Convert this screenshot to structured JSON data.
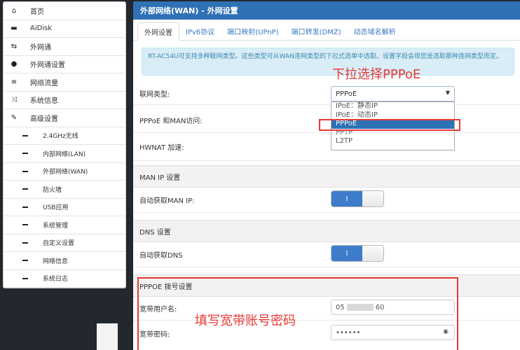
{
  "sidebar": {
    "items": [
      {
        "icon": "home-icon",
        "glyph": "⌂",
        "label": "首页"
      },
      {
        "icon": "drive-icon",
        "glyph": "▬",
        "label": "AiDisk"
      },
      {
        "icon": "guest-network-icon",
        "glyph": "⇆",
        "label": "外网通"
      },
      {
        "icon": "globe-icon",
        "glyph": "●",
        "label": "外网通设置"
      },
      {
        "icon": "traffic-icon",
        "glyph": "≡",
        "label": "网络流量"
      },
      {
        "icon": "shuffle-icon",
        "glyph": "⤨",
        "label": "系统信息"
      },
      {
        "icon": "wrench-icon",
        "glyph": "✎",
        "label": "高级设置"
      }
    ],
    "sub_items": [
      {
        "label": "2.4GHz无线"
      },
      {
        "label": "内部网络(LAN)"
      },
      {
        "label": "外部网络(WAN)"
      },
      {
        "label": "防火墙"
      },
      {
        "label": "USB应用"
      },
      {
        "label": "系统管理"
      },
      {
        "label": "自定义设置"
      },
      {
        "label": "网络信息"
      },
      {
        "label": "系统日志"
      }
    ]
  },
  "header": {
    "title": "外部网络(WAN) - 外网设置"
  },
  "tabs": [
    "外网设置",
    "IPv6协议",
    "端口映射(UPnP)",
    "端口转发(DMZ)",
    "动态域名解析"
  ],
  "info_text": "RT-AC54U可支持多种联网类型。这些类型可从WAN连网类型的下拉式选单中选取。设置字段会视您是选取那种连网类型而定。",
  "form": {
    "wan_type_label": "联网类型:",
    "wan_type_value": "PPPoE",
    "dropdown_options": [
      "IPoE：静态IP",
      "IPoE：动态IP",
      "PPPoE",
      "PPTP",
      "L2TP"
    ],
    "pppoe_man_label": "PPPoE 和MAN访问:",
    "hwnat_label": "HWNAT 加速:",
    "man_ip_section": "MAN IP 设置",
    "auto_man_ip_label": "自动获取MAN IP:",
    "toggle_on_label": "I",
    "dns_section": "DNS 设置",
    "auto_dns_label": "自动获取DNS",
    "pppoe_section": "PPPOE 拨号设置",
    "username_label": "宽带用户名:",
    "username_prefix": "05",
    "username_suffix": "60",
    "password_label": "宽带密码:",
    "password_value": "••••••"
  },
  "annotations": {
    "dropdown_hint": "下拉选择PPPoE",
    "credential_hint": "填写宽带账号密码",
    "color": "#e53935"
  }
}
